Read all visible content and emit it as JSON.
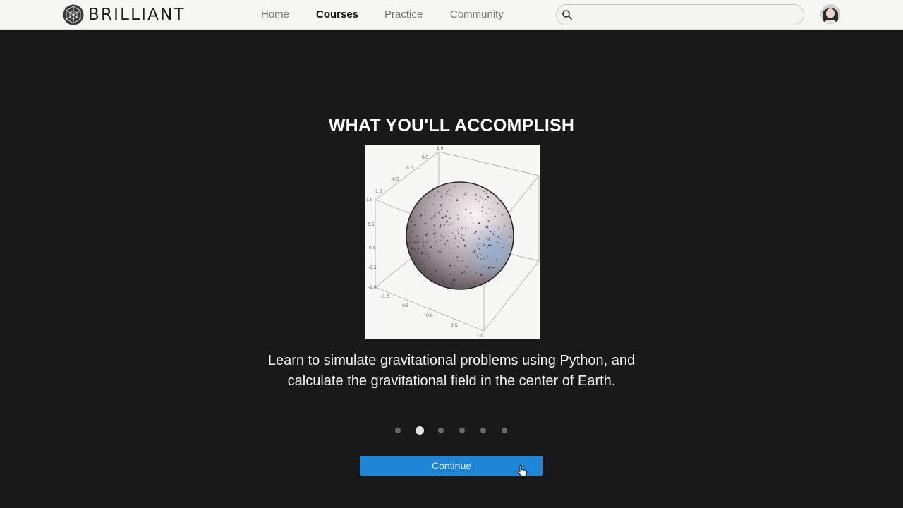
{
  "header": {
    "brand": "BRILLIANT",
    "logo_icon": "geodesic-sphere-icon",
    "nav": [
      {
        "label": "Home",
        "active": false
      },
      {
        "label": "Courses",
        "active": true
      },
      {
        "label": "Practice",
        "active": false
      },
      {
        "label": "Community",
        "active": false
      }
    ],
    "search": {
      "placeholder": "",
      "value": "",
      "icon": "search-icon"
    },
    "avatar_icon": "user-avatar-icon"
  },
  "main": {
    "title": "WHAT YOU'LL ACCOMPLISH",
    "figure": {
      "description_icon": "3d-sphere-plot",
      "tick_labels": [
        "1.0",
        "0.5",
        "0.0",
        "-0.5",
        "-1.0",
        "-1.0",
        "-0.5",
        "0.0",
        "0.5",
        "1.0",
        "1.0",
        "0.5",
        "0.0",
        "-0.5",
        "-1.0"
      ]
    },
    "description_line1": "Learn to simulate gravitational problems using Python, and",
    "description_line2": "calculate the gravitational field in the center of Earth.",
    "pagination": {
      "total": 6,
      "active_index": 1
    },
    "continue_label": "Continue"
  },
  "colors": {
    "background": "#191919",
    "header": "#f6f6f4",
    "accent": "#1e84d6"
  }
}
